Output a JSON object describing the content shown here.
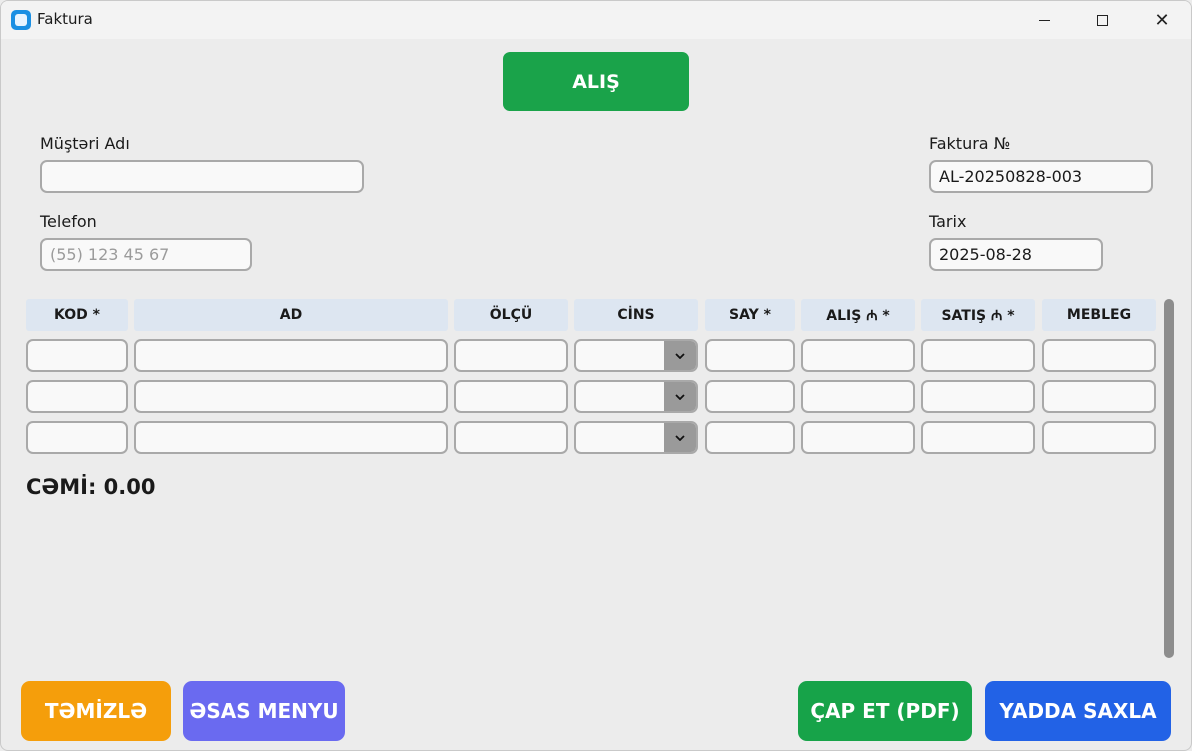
{
  "window": {
    "title": "Faktura"
  },
  "mode_button": "ALIŞ",
  "form": {
    "customer_label": "Müştəri Adı",
    "customer_value": "",
    "phone_label": "Telefon",
    "phone_placeholder": "(55) 123 45 67",
    "invoice_label": "Faktura №",
    "invoice_value": "AL-20250828-003",
    "date_label": "Tarix",
    "date_value": "2025-08-28"
  },
  "table": {
    "headers": [
      "KOD *",
      "AD",
      "ÖLÇÜ",
      "CİNS",
      "SAY *",
      "ALIŞ ₼ *",
      "SATIŞ ₼ *",
      "MEBLEG"
    ],
    "rows": [
      [
        "",
        "",
        "",
        "",
        "",
        "",
        "",
        ""
      ],
      [
        "",
        "",
        "",
        "",
        "",
        "",
        "",
        ""
      ],
      [
        "",
        "",
        "",
        "",
        "",
        "",
        "",
        ""
      ]
    ]
  },
  "total_text": "CƏMİ: 0.00",
  "buttons": {
    "clear": "TƏMİZLƏ",
    "main_menu": "ƏSAS MENYU",
    "print_pdf": "ÇAP ET (PDF)",
    "save": "YADDA SAXLA"
  },
  "colors": {
    "mode_green": "#1aa34a",
    "clear_orange": "#f59e0b",
    "menu_purple": "#6a6af0",
    "pdf_green": "#17a349",
    "save_blue": "#2262e6",
    "header_bg": "#dde6f1"
  },
  "icons": {
    "app": "app-icon",
    "minimize": "minimize-icon",
    "maximize": "maximize-icon",
    "close": "close-icon",
    "dropdown": "chevron-down-icon"
  }
}
